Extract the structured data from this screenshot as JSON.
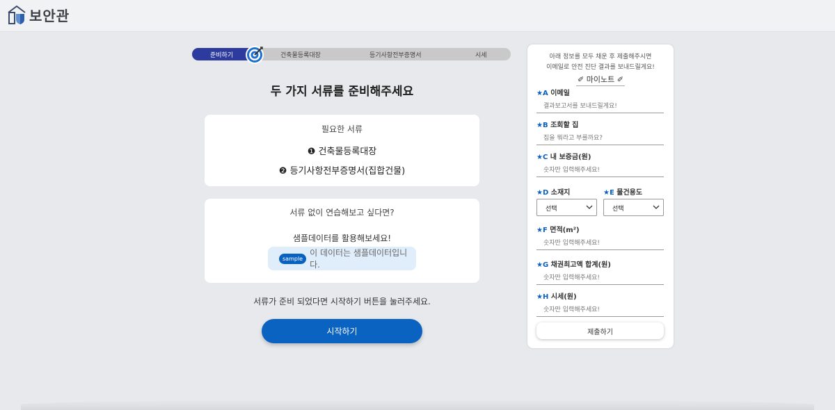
{
  "app": {
    "logo_text": "보안관"
  },
  "progress": {
    "steps": [
      "준비하기",
      "건축물등록대장",
      "등기사항전부증명서",
      "시세"
    ],
    "current_step": 1
  },
  "main": {
    "title": "두 가지 서류를 준비해주세요",
    "required_docs": {
      "heading": "필요한 서류",
      "items": [
        "❶ 건축물등록대장",
        "❷ 등기사항전부증명서(집합건물)"
      ]
    },
    "sample": {
      "question": "서류 없이 연습해보고 싶다면?",
      "cta": "샘플데이터를 활용해보세요!",
      "badge": "sample",
      "badge_text": "이 데이터는 샘플데이터입니다."
    },
    "instruction": "서류가 준비 되었다면 시작하기 버튼을 눌러주세요.",
    "start_button": "시작하기"
  },
  "panel": {
    "note_line1": "아래 정보를 모두 채운 후 제출해주시면",
    "note_line2": "이메일로 안전 진단 결과를 보내드릴게요!",
    "notebook_title": "마이노트",
    "fields": {
      "email": {
        "mark": "★A",
        "label": "이메일",
        "placeholder": "결과보고서를 보내드릴게요!"
      },
      "house": {
        "mark": "★B",
        "label": "조회할 집",
        "placeholder": "집을 뭐라고 부를까요?"
      },
      "deposit": {
        "mark": "★C",
        "label": "내 보증금(원)",
        "placeholder": "숫자만 입력해주세요!"
      },
      "location": {
        "mark": "★D",
        "label": "소재지",
        "value": "선택"
      },
      "usage": {
        "mark": "★E",
        "label": "물건용도",
        "value": "선택"
      },
      "area": {
        "mark": "★F",
        "label": "면적(m²)",
        "placeholder": "숫자만 입력해주세요!"
      },
      "max_claim": {
        "mark": "★G",
        "label": "채권최고액 합계(원)",
        "placeholder": "숫자만 입력해주세요!"
      },
      "market_price": {
        "mark": "★H",
        "label": "시세(원)",
        "placeholder": "숫자만 입력해주세요!"
      }
    },
    "submit_button": "제출하기"
  },
  "colors": {
    "primary": "#0b63c1",
    "progress_active": "#2d3b9e",
    "accent_star": "#0a5fc0",
    "background": "#e7e9ec"
  }
}
